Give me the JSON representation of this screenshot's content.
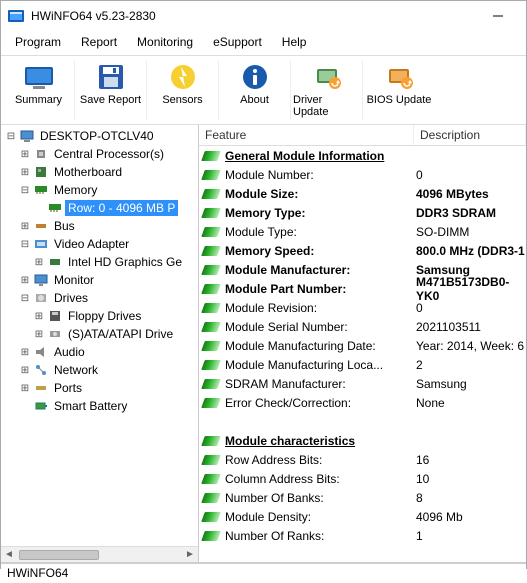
{
  "window": {
    "title": "HWiNFO64 v5.23-2830"
  },
  "menu": {
    "items": [
      "Program",
      "Report",
      "Monitoring",
      "eSupport",
      "Help"
    ]
  },
  "toolbar": {
    "summary": "Summary",
    "save_report": "Save Report",
    "sensors": "Sensors",
    "about": "About",
    "driver_update": "Driver Update",
    "bios_update": "BIOS Update"
  },
  "tree": {
    "root": "DESKTOP-OTCLV40",
    "cpu": "Central Processor(s)",
    "motherboard": "Motherboard",
    "memory": "Memory",
    "memory_row": "Row: 0 - 4096 MB P",
    "bus": "Bus",
    "video_adapter": "Video Adapter",
    "intel_hd": "Intel HD Graphics Ge",
    "monitor": "Monitor",
    "drives": "Drives",
    "floppy": "Floppy Drives",
    "sata": "(S)ATA/ATAPI Drive",
    "audio": "Audio",
    "network": "Network",
    "ports": "Ports",
    "smart_battery": "Smart Battery"
  },
  "columns": {
    "feature": "Feature",
    "description": "Description"
  },
  "sections": {
    "general": "General Module Information",
    "characteristics": "Module characteristics"
  },
  "props": {
    "module_number": {
      "label": "Module Number:",
      "value": "0"
    },
    "module_size": {
      "label": "Module Size:",
      "value": "4096 MBytes"
    },
    "memory_type": {
      "label": "Memory Type:",
      "value": "DDR3 SDRAM"
    },
    "module_type": {
      "label": "Module Type:",
      "value": "SO-DIMM"
    },
    "memory_speed": {
      "label": "Memory Speed:",
      "value": "800.0 MHz (DDR3-1"
    },
    "module_manufacturer": {
      "label": "Module Manufacturer:",
      "value": "Samsung"
    },
    "module_part_number": {
      "label": "Module Part Number:",
      "value": "M471B5173DB0-YK0"
    },
    "module_revision": {
      "label": "Module Revision:",
      "value": "0"
    },
    "module_serial": {
      "label": "Module Serial Number:",
      "value": "2021103511"
    },
    "module_mfg_date": {
      "label": "Module Manufacturing Date:",
      "value": "Year: 2014, Week: 6"
    },
    "module_mfg_loc": {
      "label": "Module Manufacturing Loca...",
      "value": "2"
    },
    "sdram_manufacturer": {
      "label": "SDRAM Manufacturer:",
      "value": "Samsung"
    },
    "error_check": {
      "label": "Error Check/Correction:",
      "value": "None"
    },
    "row_addr_bits": {
      "label": "Row Address Bits:",
      "value": "16"
    },
    "col_addr_bits": {
      "label": "Column Address Bits:",
      "value": "10"
    },
    "num_banks": {
      "label": "Number Of Banks:",
      "value": "8"
    },
    "module_density": {
      "label": "Module Density:",
      "value": "4096 Mb"
    },
    "num_ranks": {
      "label": "Number Of Ranks:",
      "value": "1"
    }
  },
  "status": "HWiNFO64"
}
